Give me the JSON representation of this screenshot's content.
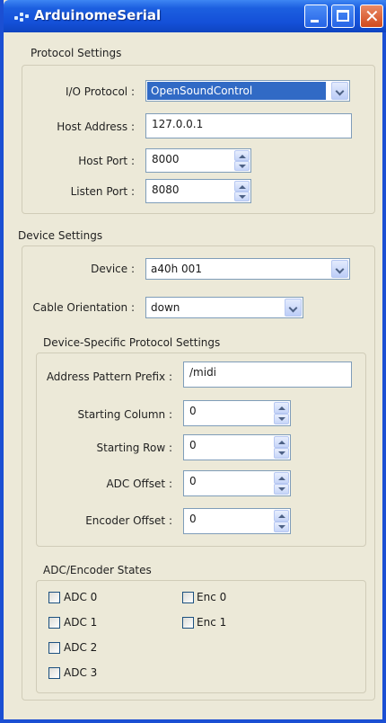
{
  "window": {
    "title": "ArduinomeSerial"
  },
  "protocol": {
    "section_title": "Protocol Settings",
    "io_label": "I/O Protocol :",
    "io_value": "OpenSoundControl",
    "host_address_label": "Host Address :",
    "host_address_value": "127.0.0.1",
    "host_port_label": "Host Port :",
    "host_port_value": "8000",
    "listen_port_label": "Listen Port :",
    "listen_port_value": "8080"
  },
  "device": {
    "section_title": "Device Settings",
    "device_label": "Device :",
    "device_value": "a40h 001",
    "cable_label": "Cable Orientation :",
    "cable_value": "down"
  },
  "device_protocol": {
    "section_title": "Device-Specific Protocol Settings",
    "prefix_label": "Address Pattern Prefix :",
    "prefix_value": "/midi",
    "start_col_label": "Starting Column :",
    "start_col_value": "0",
    "start_row_label": "Starting Row :",
    "start_row_value": "0",
    "adc_offset_label": "ADC Offset :",
    "adc_offset_value": "0",
    "enc_offset_label": "Encoder Offset :",
    "enc_offset_value": "0"
  },
  "states": {
    "section_title": "ADC/Encoder States",
    "adc": [
      {
        "label": "ADC 0",
        "checked": false
      },
      {
        "label": "ADC 1",
        "checked": false
      },
      {
        "label": "ADC 2",
        "checked": false
      },
      {
        "label": "ADC 3",
        "checked": false
      }
    ],
    "enc": [
      {
        "label": "Enc 0",
        "checked": false
      },
      {
        "label": "Enc 1",
        "checked": false
      }
    ]
  },
  "colors": {
    "titlebar": "#1c5fe0",
    "window_bg": "#ece9d8",
    "selection": "#316ac5",
    "close_button": "#d24a1c"
  }
}
